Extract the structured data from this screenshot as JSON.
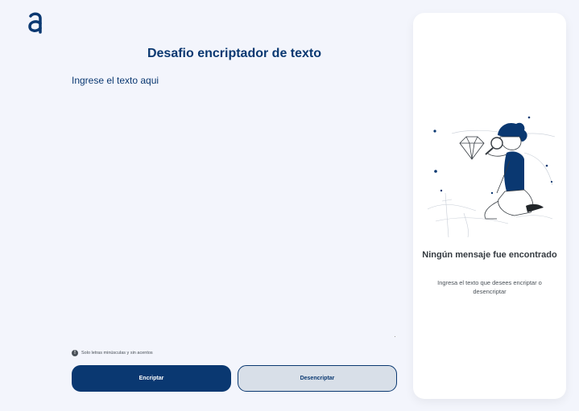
{
  "header": {
    "logo_icon": "alura-a-logo-icon",
    "title": "Desafio encriptador de texto"
  },
  "input": {
    "placeholder": "Ingrese el texto aqui",
    "value": ""
  },
  "hint": {
    "icon": "info-icon",
    "text": "Solo letras minúsculas y sin acentos"
  },
  "buttons": {
    "encrypt_label": "Encriptar",
    "decrypt_label": "Desencriptar"
  },
  "result_panel": {
    "illustration": "person-magnifying-glass-diamond-illustration",
    "title": "Ningún mensaje fue encontrado",
    "subtitle": "Ingresa el texto que desees encriptar o desencriptar"
  },
  "colors": {
    "primary": "#0a3871",
    "background": "#f3f5fc",
    "panel": "#ffffff",
    "secondary_button": "#d8dfe8"
  }
}
